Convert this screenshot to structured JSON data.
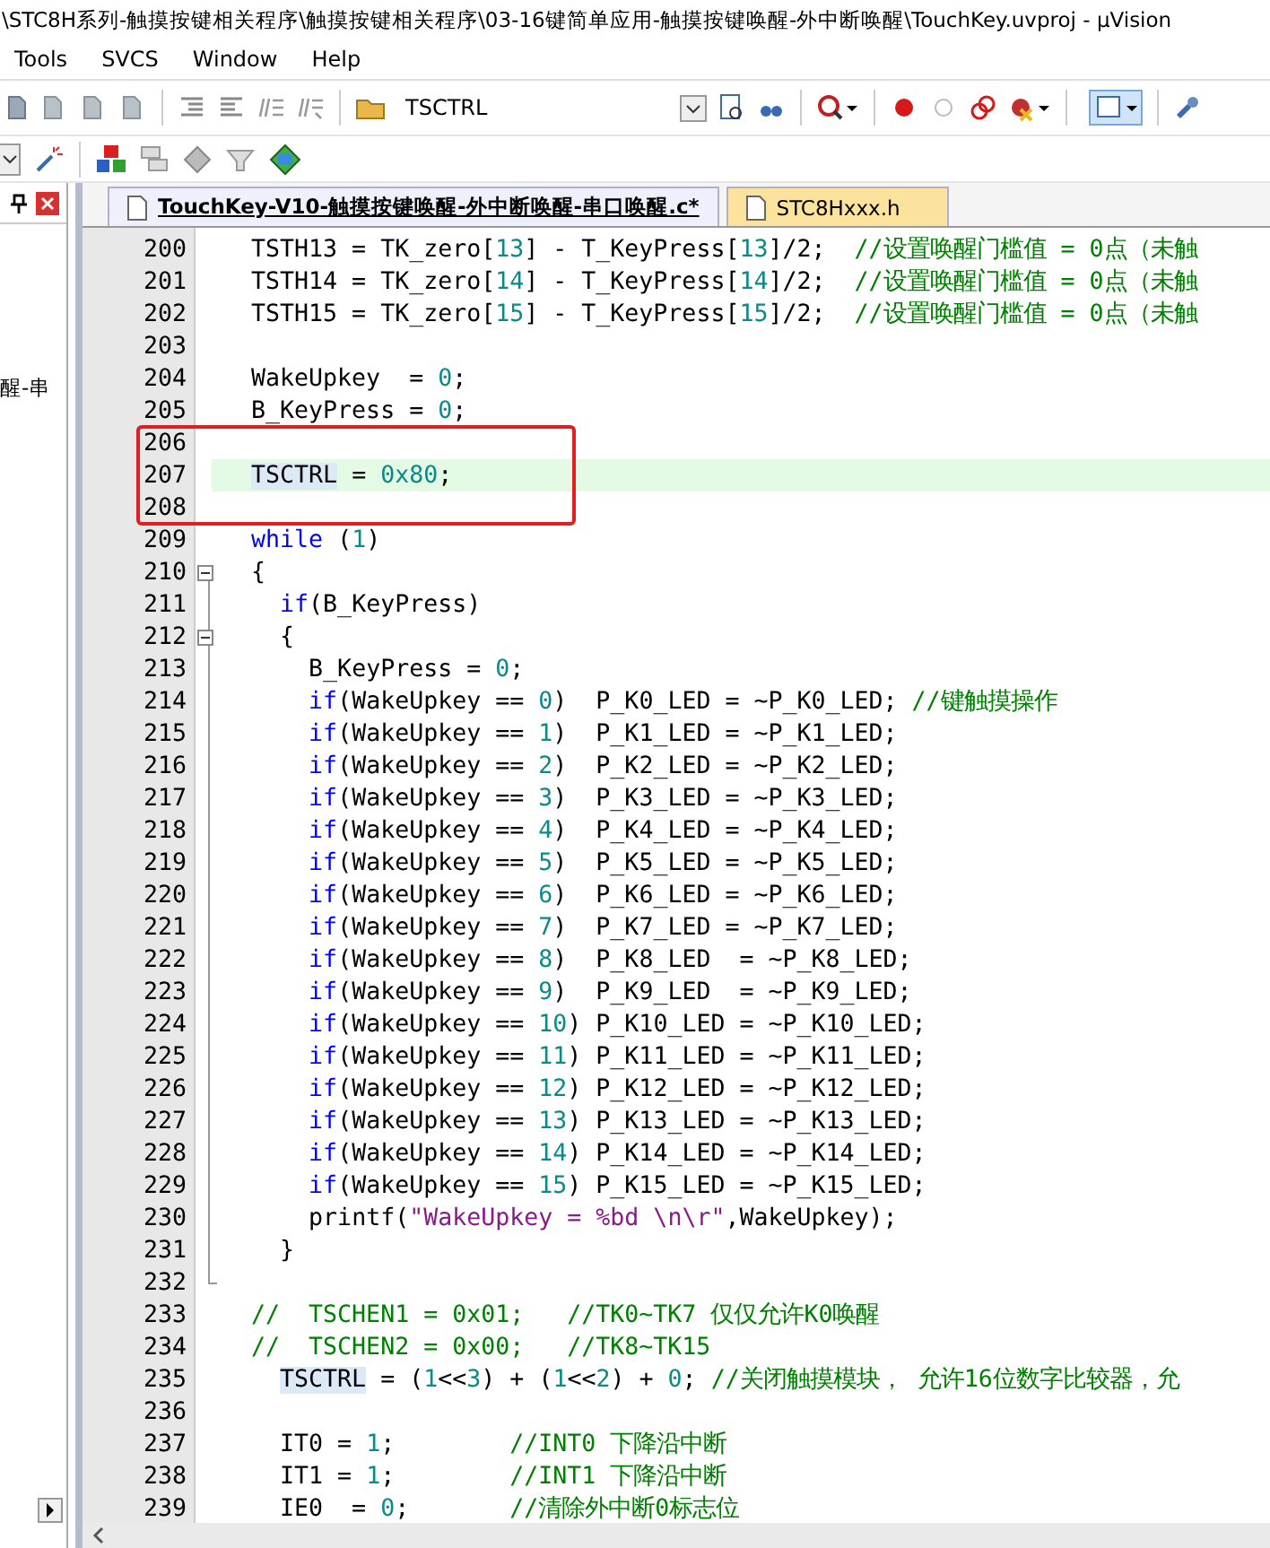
{
  "window": {
    "title": "\\STC8H系列-触摸按键相关程序\\触摸按键相关程序\\03-16键简单应用-触摸按键唤醒-外中断唤醒\\TouchKey.uvproj - µVision"
  },
  "menu": [
    "Tools",
    "SVCS",
    "Window",
    "Help"
  ],
  "toolbar": {
    "find_value": "TSCTRL"
  },
  "side_panel": {
    "text": "醒-串"
  },
  "tabs": [
    {
      "label": "TouchKey-V10-触摸按键唤醒-外中断唤醒-串口唤醒.c*",
      "selected": true
    },
    {
      "label": "STC8Hxxx.h",
      "selected": false
    }
  ],
  "editor": {
    "lines": [
      {
        "number": "200",
        "current": false,
        "boxed": false,
        "tokens": [
          {
            "kind": "plain",
            "text": "  TSTH13 = TK_zero["
          },
          {
            "kind": "number",
            "text": "13"
          },
          {
            "kind": "plain",
            "text": "] - T_KeyPress["
          },
          {
            "kind": "number",
            "text": "13"
          },
          {
            "kind": "plain",
            "text": "]/2;  "
          },
          {
            "kind": "comment",
            "text": "//设置唤醒门槛值 = 0点（未触"
          }
        ]
      },
      {
        "number": "201",
        "current": false,
        "boxed": false,
        "tokens": [
          {
            "kind": "plain",
            "text": "  TSTH14 = TK_zero["
          },
          {
            "kind": "number",
            "text": "14"
          },
          {
            "kind": "plain",
            "text": "] - T_KeyPress["
          },
          {
            "kind": "number",
            "text": "14"
          },
          {
            "kind": "plain",
            "text": "]/2;  "
          },
          {
            "kind": "comment",
            "text": "//设置唤醒门槛值 = 0点（未触"
          }
        ]
      },
      {
        "number": "202",
        "current": false,
        "boxed": false,
        "tokens": [
          {
            "kind": "plain",
            "text": "  TSTH15 = TK_zero["
          },
          {
            "kind": "number",
            "text": "15"
          },
          {
            "kind": "plain",
            "text": "] - T_KeyPress["
          },
          {
            "kind": "number",
            "text": "15"
          },
          {
            "kind": "plain",
            "text": "]/2;  "
          },
          {
            "kind": "comment",
            "text": "//设置唤醒门槛值 = 0点（未触"
          }
        ]
      },
      {
        "number": "203",
        "current": false,
        "boxed": false
      },
      {
        "number": "204",
        "current": false,
        "boxed": false,
        "tokens": [
          {
            "kind": "plain",
            "text": "  WakeUpkey  = "
          },
          {
            "kind": "number",
            "text": "0"
          },
          {
            "kind": "plain",
            "text": ";"
          }
        ]
      },
      {
        "number": "205",
        "current": false,
        "boxed": false,
        "tokens": [
          {
            "kind": "plain",
            "text": "  B_KeyPress = "
          },
          {
            "kind": "number",
            "text": "0"
          },
          {
            "kind": "plain",
            "text": ";"
          }
        ]
      },
      {
        "number": "206",
        "current": false,
        "boxed": true
      },
      {
        "number": "207",
        "current": true,
        "boxed": true,
        "tokens": [
          {
            "kind": "match",
            "text": "  TSCTRL"
          },
          {
            "kind": "plain",
            "text": " = "
          },
          {
            "kind": "number",
            "text": "0x80"
          },
          {
            "kind": "plain",
            "text": ";"
          }
        ]
      },
      {
        "number": "208",
        "current": false,
        "boxed": true
      },
      {
        "number": "209",
        "current": false,
        "boxed": false,
        "tokens": [
          {
            "kind": "keyword",
            "text": "  while"
          },
          {
            "kind": "plain",
            "text": " ("
          },
          {
            "kind": "number",
            "text": "1"
          },
          {
            "kind": "plain",
            "text": ")"
          }
        ]
      },
      {
        "number": "210",
        "current": false,
        "boxed": false,
        "kind": "fold_start",
        "expanded": true,
        "tokens": [
          {
            "kind": "plain",
            "text": "  {"
          }
        ]
      },
      {
        "number": "211",
        "current": false,
        "boxed": false,
        "tokens": [
          {
            "kind": "keyword",
            "text": "    if"
          },
          {
            "kind": "plain",
            "text": "(B_KeyPress)"
          }
        ]
      },
      {
        "number": "212",
        "current": false,
        "boxed": false,
        "kind": "fold_start",
        "expanded": true,
        "tokens": [
          {
            "kind": "plain",
            "text": "    {"
          }
        ]
      },
      {
        "number": "213",
        "current": false,
        "boxed": false,
        "tokens": [
          {
            "kind": "plain",
            "text": "      B_KeyPress = "
          },
          {
            "kind": "number",
            "text": "0"
          },
          {
            "kind": "plain",
            "text": ";"
          }
        ]
      },
      {
        "number": "214",
        "current": false,
        "boxed": false,
        "tokens": [
          {
            "kind": "keyword",
            "text": "      if"
          },
          {
            "kind": "plain",
            "text": "(WakeUpkey == "
          },
          {
            "kind": "number",
            "text": "0"
          },
          {
            "kind": "plain",
            "text": ")  P_K0_LED = ~P_K0_LED; "
          },
          {
            "kind": "comment",
            "text": "//键触摸操作"
          }
        ]
      },
      {
        "number": "215",
        "current": false,
        "boxed": false,
        "tokens": [
          {
            "kind": "keyword",
            "text": "      if"
          },
          {
            "kind": "plain",
            "text": "(WakeUpkey == "
          },
          {
            "kind": "number",
            "text": "1"
          },
          {
            "kind": "plain",
            "text": ")  P_K1_LED = ~P_K1_LED;"
          }
        ]
      },
      {
        "number": "216",
        "current": false,
        "boxed": false,
        "tokens": [
          {
            "kind": "keyword",
            "text": "      if"
          },
          {
            "kind": "plain",
            "text": "(WakeUpkey == "
          },
          {
            "kind": "number",
            "text": "2"
          },
          {
            "kind": "plain",
            "text": ")  P_K2_LED = ~P_K2_LED;"
          }
        ]
      },
      {
        "number": "217",
        "current": false,
        "boxed": false,
        "tokens": [
          {
            "kind": "keyword",
            "text": "      if"
          },
          {
            "kind": "plain",
            "text": "(WakeUpkey == "
          },
          {
            "kind": "number",
            "text": "3"
          },
          {
            "kind": "plain",
            "text": ")  P_K3_LED = ~P_K3_LED;"
          }
        ]
      },
      {
        "number": "218",
        "current": false,
        "boxed": false,
        "tokens": [
          {
            "kind": "keyword",
            "text": "      if"
          },
          {
            "kind": "plain",
            "text": "(WakeUpkey == "
          },
          {
            "kind": "number",
            "text": "4"
          },
          {
            "kind": "plain",
            "text": ")  P_K4_LED = ~P_K4_LED;"
          }
        ]
      },
      {
        "number": "219",
        "current": false,
        "boxed": false,
        "tokens": [
          {
            "kind": "keyword",
            "text": "      if"
          },
          {
            "kind": "plain",
            "text": "(WakeUpkey == "
          },
          {
            "kind": "number",
            "text": "5"
          },
          {
            "kind": "plain",
            "text": ")  P_K5_LED = ~P_K5_LED;"
          }
        ]
      },
      {
        "number": "220",
        "current": false,
        "boxed": false,
        "tokens": [
          {
            "kind": "keyword",
            "text": "      if"
          },
          {
            "kind": "plain",
            "text": "(WakeUpkey == "
          },
          {
            "kind": "number",
            "text": "6"
          },
          {
            "kind": "plain",
            "text": ")  P_K6_LED = ~P_K6_LED;"
          }
        ]
      },
      {
        "number": "221",
        "current": false,
        "boxed": false,
        "tokens": [
          {
            "kind": "keyword",
            "text": "      if"
          },
          {
            "kind": "plain",
            "text": "(WakeUpkey == "
          },
          {
            "kind": "number",
            "text": "7"
          },
          {
            "kind": "plain",
            "text": ")  P_K7_LED = ~P_K7_LED;"
          }
        ]
      },
      {
        "number": "222",
        "current": false,
        "boxed": false,
        "tokens": [
          {
            "kind": "keyword",
            "text": "      if"
          },
          {
            "kind": "plain",
            "text": "(WakeUpkey == "
          },
          {
            "kind": "number",
            "text": "8"
          },
          {
            "kind": "plain",
            "text": ")  P_K8_LED  = ~P_K8_LED;"
          }
        ]
      },
      {
        "number": "223",
        "current": false,
        "boxed": false,
        "tokens": [
          {
            "kind": "keyword",
            "text": "      if"
          },
          {
            "kind": "plain",
            "text": "(WakeUpkey == "
          },
          {
            "kind": "number",
            "text": "9"
          },
          {
            "kind": "plain",
            "text": ")  P_K9_LED  = ~P_K9_LED;"
          }
        ]
      },
      {
        "number": "224",
        "current": false,
        "boxed": false,
        "tokens": [
          {
            "kind": "keyword",
            "text": "      if"
          },
          {
            "kind": "plain",
            "text": "(WakeUpkey == "
          },
          {
            "kind": "number",
            "text": "10"
          },
          {
            "kind": "plain",
            "text": ") P_K10_LED = ~P_K10_LED;"
          }
        ]
      },
      {
        "number": "225",
        "current": false,
        "boxed": false,
        "tokens": [
          {
            "kind": "keyword",
            "text": "      if"
          },
          {
            "kind": "plain",
            "text": "(WakeUpkey == "
          },
          {
            "kind": "number",
            "text": "11"
          },
          {
            "kind": "plain",
            "text": ") P_K11_LED = ~P_K11_LED;"
          }
        ]
      },
      {
        "number": "226",
        "current": false,
        "boxed": false,
        "tokens": [
          {
            "kind": "keyword",
            "text": "      if"
          },
          {
            "kind": "plain",
            "text": "(WakeUpkey == "
          },
          {
            "kind": "number",
            "text": "12"
          },
          {
            "kind": "plain",
            "text": ") P_K12_LED = ~P_K12_LED;"
          }
        ]
      },
      {
        "number": "227",
        "current": false,
        "boxed": false,
        "tokens": [
          {
            "kind": "keyword",
            "text": "      if"
          },
          {
            "kind": "plain",
            "text": "(WakeUpkey == "
          },
          {
            "kind": "number",
            "text": "13"
          },
          {
            "kind": "plain",
            "text": ") P_K13_LED = ~P_K13_LED;"
          }
        ]
      },
      {
        "number": "228",
        "current": false,
        "boxed": false,
        "tokens": [
          {
            "kind": "keyword",
            "text": "      if"
          },
          {
            "kind": "plain",
            "text": "(WakeUpkey == "
          },
          {
            "kind": "number",
            "text": "14"
          },
          {
            "kind": "plain",
            "text": ") P_K14_LED = ~P_K14_LED;"
          }
        ]
      },
      {
        "number": "229",
        "current": false,
        "boxed": false,
        "tokens": [
          {
            "kind": "keyword",
            "text": "      if"
          },
          {
            "kind": "plain",
            "text": "(WakeUpkey == "
          },
          {
            "kind": "number",
            "text": "15"
          },
          {
            "kind": "plain",
            "text": ") P_K15_LED = ~P_K15_LED;"
          }
        ]
      },
      {
        "number": "230",
        "current": false,
        "boxed": false,
        "tokens": [
          {
            "kind": "plain",
            "text": "      printf("
          },
          {
            "kind": "string",
            "text": "\"WakeUpkey = %bd \\n\\r\""
          },
          {
            "kind": "plain",
            "text": ",WakeUpkey);"
          }
        ]
      },
      {
        "number": "231",
        "current": false,
        "boxed": false,
        "tokens": [
          {
            "kind": "plain",
            "text": "    }"
          }
        ]
      },
      {
        "number": "232",
        "current": false,
        "boxed": false,
        "kind": "fold_end"
      },
      {
        "number": "233",
        "current": false,
        "boxed": false,
        "tokens": [
          {
            "kind": "comment",
            "text": "  //  TSCHEN1 = 0x01;   //TK0~TK7 仅仅允许K0唤醒"
          }
        ]
      },
      {
        "number": "234",
        "current": false,
        "boxed": false,
        "tokens": [
          {
            "kind": "comment",
            "text": "  //  TSCHEN2 = 0x00;   //TK8~TK15"
          }
        ]
      },
      {
        "number": "235",
        "current": false,
        "boxed": false,
        "tokens": [
          {
            "kind": "match",
            "text": "    TSCTRL"
          },
          {
            "kind": "plain",
            "text": " = ("
          },
          {
            "kind": "number",
            "text": "1"
          },
          {
            "kind": "plain",
            "text": "<<"
          },
          {
            "kind": "number",
            "text": "3"
          },
          {
            "kind": "plain",
            "text": ") + ("
          },
          {
            "kind": "number",
            "text": "1"
          },
          {
            "kind": "plain",
            "text": "<<"
          },
          {
            "kind": "number",
            "text": "2"
          },
          {
            "kind": "plain",
            "text": ") + "
          },
          {
            "kind": "number",
            "text": "0"
          },
          {
            "kind": "plain",
            "text": "; "
          },
          {
            "kind": "comment",
            "text": "//关闭触摸模块， 允许16位数字比较器，允"
          }
        ]
      },
      {
        "number": "236",
        "current": false,
        "boxed": false
      },
      {
        "number": "237",
        "current": false,
        "boxed": false,
        "tokens": [
          {
            "kind": "plain",
            "text": "    IT0 = "
          },
          {
            "kind": "number",
            "text": "1"
          },
          {
            "kind": "plain",
            "text": ";        "
          },
          {
            "kind": "comment",
            "text": "//INT0 下降沿中断"
          }
        ]
      },
      {
        "number": "238",
        "current": false,
        "boxed": false,
        "tokens": [
          {
            "kind": "plain",
            "text": "    IT1 = "
          },
          {
            "kind": "number",
            "text": "1"
          },
          {
            "kind": "plain",
            "text": ";        "
          },
          {
            "kind": "comment",
            "text": "//INT1 下降沿中断"
          }
        ]
      },
      {
        "number": "239",
        "current": false,
        "boxed": false,
        "tokens": [
          {
            "kind": "plain",
            "text": "    IE0  = "
          },
          {
            "kind": "number",
            "text": "0"
          },
          {
            "kind": "plain",
            "text": ";       "
          },
          {
            "kind": "comment",
            "text": "//清除外中断0标志位"
          }
        ]
      }
    ]
  }
}
